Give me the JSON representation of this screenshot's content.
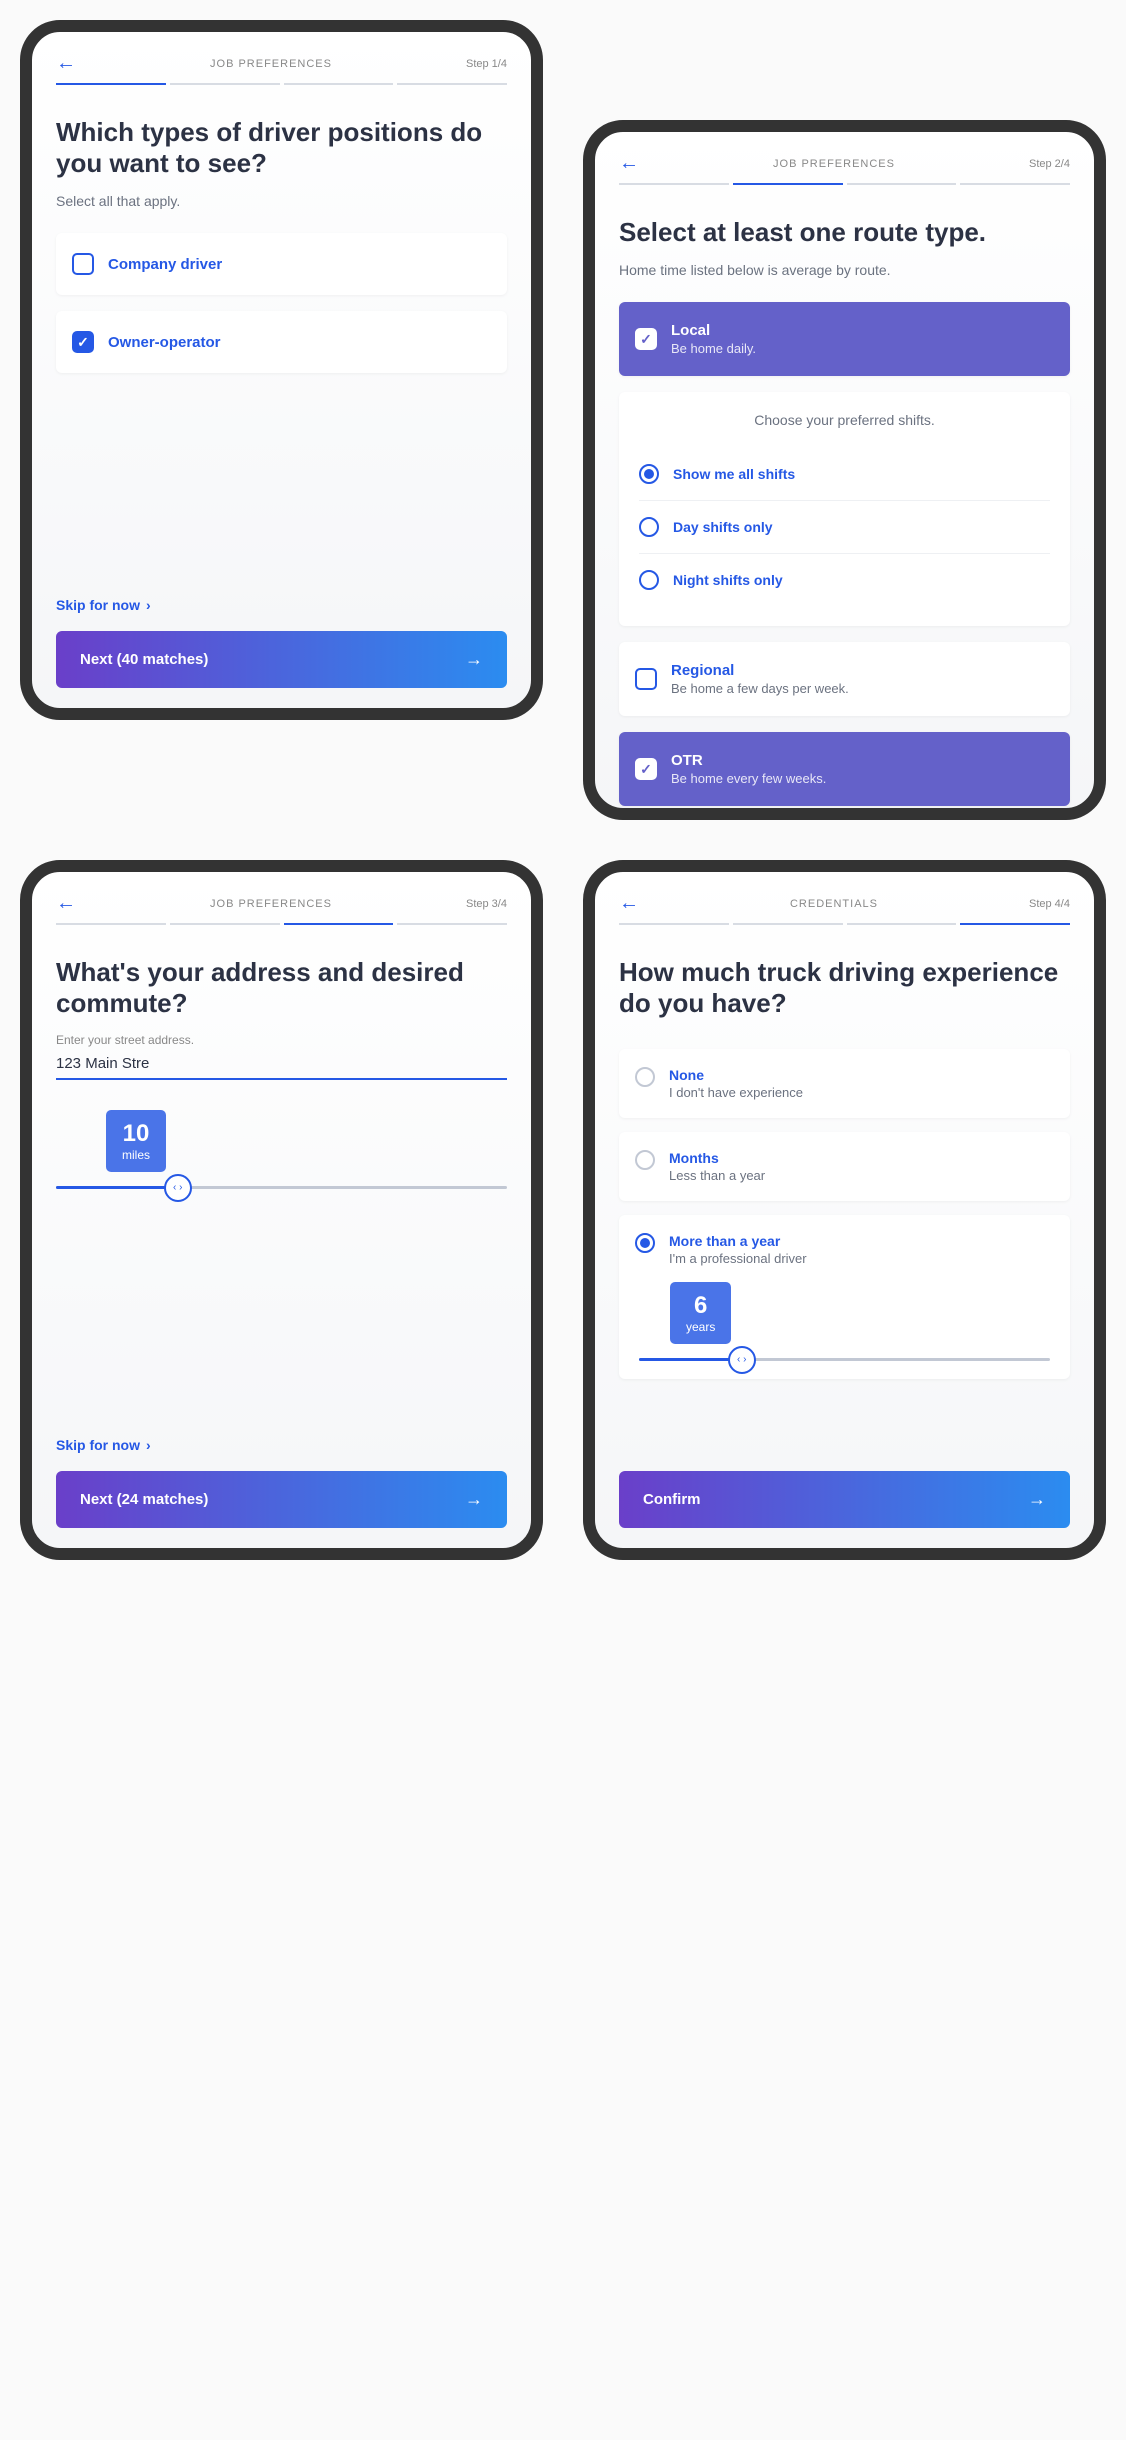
{
  "screens": {
    "s1": {
      "header_title": "JOB PREFERENCES",
      "step": "Step 1/4",
      "question": "Which types of driver positions do you want to see?",
      "subtitle": "Select all that apply.",
      "opts": {
        "company": "Company driver",
        "owner": "Owner-operator"
      },
      "skip": "Skip for now",
      "next": "Next  (40 matches)"
    },
    "s2": {
      "header_title": "JOB PREFERENCES",
      "step": "Step 2/4",
      "question": "Select at least one route type.",
      "subtitle": "Home time listed below is average by route.",
      "local": {
        "title": "Local",
        "sub": "Be home daily."
      },
      "shifts_title": "Choose your preferred shifts.",
      "shift_all": "Show me all shifts",
      "shift_day": "Day shifts only",
      "shift_night": "Night shifts only",
      "regional": {
        "title": "Regional",
        "sub": "Be home a few days per week."
      },
      "otr": {
        "title": "OTR",
        "sub": "Be home every few weeks."
      }
    },
    "s3": {
      "header_title": "JOB PREFERENCES",
      "step": "Step 3/4",
      "question": "What's your address and desired commute?",
      "input_label": "Enter your street address.",
      "input_value": "123 Main Stre",
      "slider_val": "10",
      "slider_unit": "miles",
      "skip": "Skip for now",
      "next": "Next  (24 matches)"
    },
    "s4": {
      "header_title": "CREDENTIALS",
      "step": "Step 4/4",
      "question": "How much truck driving experience do you have?",
      "none": {
        "title": "None",
        "sub": "I don't have experience"
      },
      "months": {
        "title": "Months",
        "sub": "Less than a year"
      },
      "year": {
        "title": "More than a year",
        "sub": "I'm a professional driver"
      },
      "slider_val": "6",
      "slider_unit": "years",
      "confirm": "Confirm"
    }
  }
}
